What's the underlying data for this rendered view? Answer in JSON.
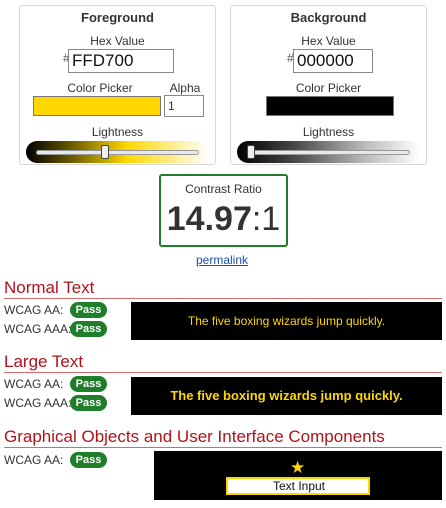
{
  "foreground": {
    "title": "Foreground",
    "hex_label": "Hex Value",
    "hash": "#",
    "hex_value": "FFD700",
    "picker_label": "Color Picker",
    "alpha_label": "Alpha",
    "alpha_value": "1",
    "lightness_label": "Lightness",
    "color": "#FFD700",
    "lightness": 0.42
  },
  "background": {
    "title": "Background",
    "hex_label": "Hex Value",
    "hash": "#",
    "hex_value": "000000",
    "picker_label": "Color Picker",
    "lightness_label": "Lightness",
    "color": "#000000",
    "lightness": 0.0
  },
  "contrast": {
    "label": "Contrast Ratio",
    "ratio_main": "14.97",
    "ratio_suffix": ":1",
    "permalink": "permalink"
  },
  "normal_text": {
    "title": "Normal Text",
    "aa_label": "WCAG AA:",
    "aa_result": "Pass",
    "aaa_label": "WCAG AAA:",
    "aaa_result": "Pass",
    "sample": "The five boxing wizards jump quickly."
  },
  "large_text": {
    "title": "Large Text",
    "aa_label": "WCAG AA:",
    "aa_result": "Pass",
    "aaa_label": "WCAG AAA:",
    "aaa_result": "Pass",
    "sample": "The five boxing wizards jump quickly."
  },
  "graphical": {
    "title": "Graphical Objects and User Interface Components",
    "aa_label": "WCAG AA:",
    "aa_result": "Pass",
    "star_icon": "★",
    "input_value": "Text Input"
  },
  "colors": {
    "pass_green": "#1e7e2a",
    "section_red": "#b0121b",
    "sample_fg": "#FFD700",
    "sample_bg": "#000000"
  }
}
